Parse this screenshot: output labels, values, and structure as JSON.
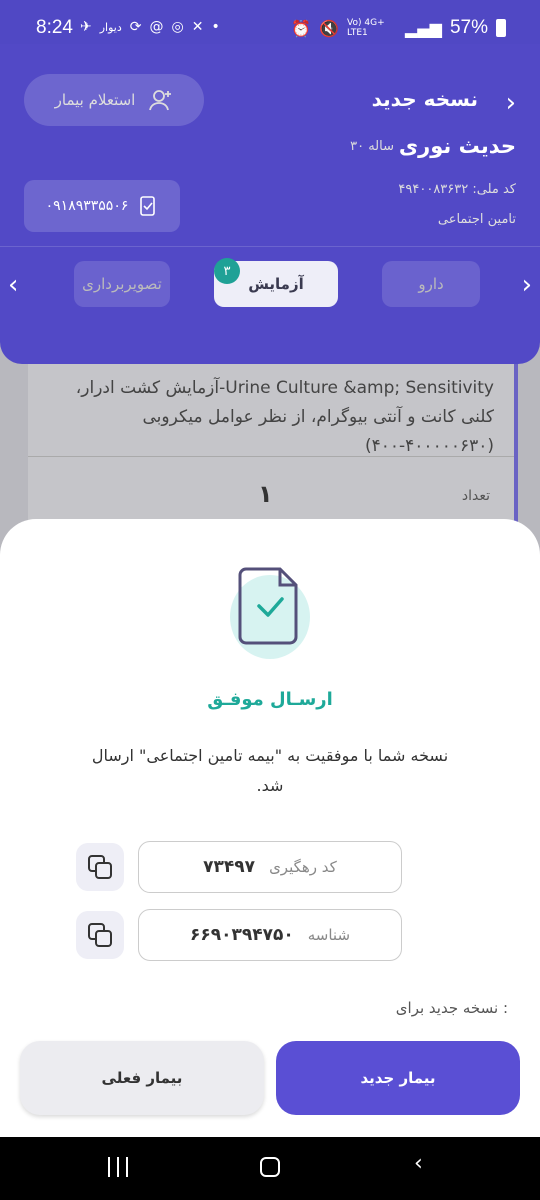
{
  "status_bar": {
    "time": "8:24",
    "app_label": "دیوار",
    "network": "Vo) 4G+ LTE1",
    "battery": "57%"
  },
  "header": {
    "title": "نسخه جدید",
    "inquiry_button": "استعلام بیمار",
    "patient_name": "حدیث نوری",
    "patient_age": "۳۰ ساله",
    "national_id": "کد ملی: ۴۹۴۰۰۸۳۶۳۲",
    "insurer": "تامین اجتماعی",
    "phone": "۰۹۱۸۹۳۳۵۵۰۶"
  },
  "tabs": {
    "drug": "دارو",
    "lab": "آزمایش",
    "lab_badge": "۳",
    "imaging": "تصویربرداری"
  },
  "background_card": {
    "test_text": "Urine Culture &amp; Sensitivity-آزمایش کشت ادرار، کلنی کانت و آنتی بیوگرام، از نظر عوامل میکروبی  (۴۰۰۰۰۰۶۳۰-۴۰۰)",
    "quantity_label": "تعداد",
    "quantity_value": "۱"
  },
  "sheet": {
    "title": "ارسـال موفـق",
    "message": "نسخه شما با موفقیت به \"بیمه تامین اجتماعی\" ارسال شد.",
    "tracking_label": "کد رهگیری",
    "tracking_value": "۷۳۴۹۷",
    "id_label": "شناسه",
    "id_value": "۶۶۹۰۳۹۴۷۵۰",
    "new_for_label": "نسخه جدید برای :",
    "new_patient_button": "بیمار جدید",
    "current_patient_button": "بیمار فعلی"
  },
  "icons": {
    "accent": "#5249c6",
    "success": "#1ea999"
  }
}
